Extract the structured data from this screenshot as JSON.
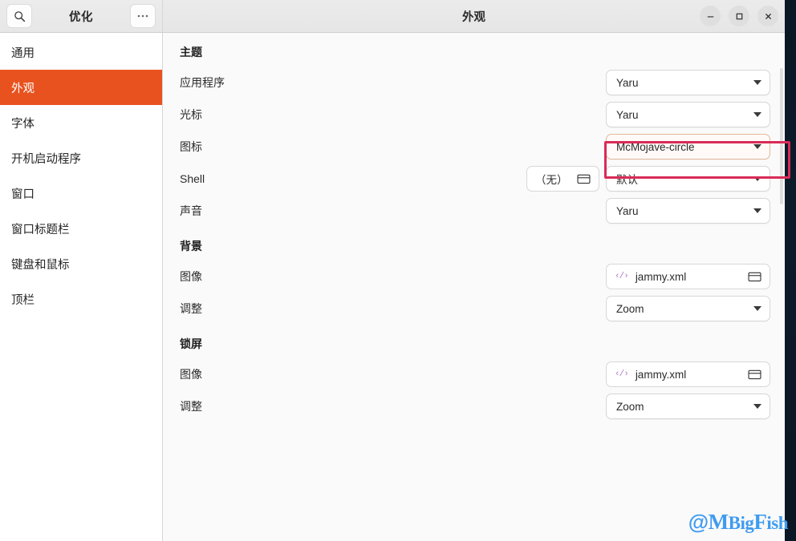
{
  "window": {
    "title": "外观",
    "sidebar_title": "优化",
    "search_icon": "search-icon",
    "menu_icon": "ellipsis-icon",
    "controls": {
      "minimize": "−",
      "maximize": "□",
      "close": "✕"
    }
  },
  "sidebar": {
    "items": [
      {
        "label": "通用",
        "active": false
      },
      {
        "label": "外观",
        "active": true
      },
      {
        "label": "字体",
        "active": false
      },
      {
        "label": "开机启动程序",
        "active": false
      },
      {
        "label": "窗口",
        "active": false
      },
      {
        "label": "窗口标题栏",
        "active": false
      },
      {
        "label": "键盘和鼠标",
        "active": false
      },
      {
        "label": "顶栏",
        "active": false
      }
    ],
    "active_color": "#e8521f"
  },
  "content": {
    "groups": [
      {
        "title": "主题",
        "rows": [
          {
            "label": "应用程序",
            "type": "combo",
            "value": "Yaru",
            "highlight": false
          },
          {
            "label": "光标",
            "type": "combo",
            "value": "Yaru",
            "highlight": false
          },
          {
            "label": "图标",
            "type": "combo",
            "value": "McMojave-circle",
            "highlight": true
          },
          {
            "label": "Shell",
            "type": "combo-with-file",
            "file_value": "（无）",
            "value": "默认",
            "highlight": false
          },
          {
            "label": "声音",
            "type": "combo",
            "value": "Yaru",
            "highlight": false
          }
        ]
      },
      {
        "title": "背景",
        "rows": [
          {
            "label": "图像",
            "type": "file",
            "value": "jammy.xml",
            "highlight": false
          },
          {
            "label": "调整",
            "type": "combo",
            "value": "Zoom",
            "highlight": false
          }
        ]
      },
      {
        "title": "锁屏",
        "rows": [
          {
            "label": "图像",
            "type": "file",
            "value": "jammy.xml",
            "highlight": false
          },
          {
            "label": "调整",
            "type": "combo",
            "value": "Zoom",
            "highlight": false
          }
        ]
      }
    ]
  },
  "annotation": {
    "color": "#d92b56",
    "target": "图标"
  },
  "watermark": {
    "at": "@",
    "m": "M",
    "big": "Big",
    "f": "F",
    "ish": "ish",
    "color": "#3f9bf0"
  }
}
